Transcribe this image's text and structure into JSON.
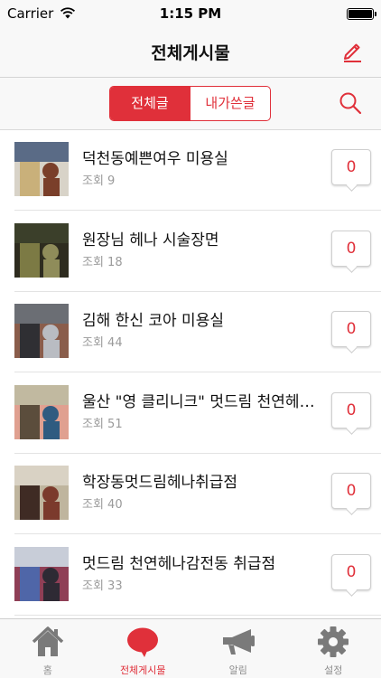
{
  "status_bar": {
    "carrier": "Carrier",
    "time": "1:15 PM"
  },
  "nav": {
    "title": "전체게시물"
  },
  "segment": {
    "all_label": "전체글",
    "mine_label": "내가쓴글"
  },
  "posts": [
    {
      "title": "덕천동예쁜여우 미용실",
      "views": "조회 9",
      "count": "0",
      "thumb_colors": [
        "#5a6b86",
        "#c9b07a",
        "#7a3f2a",
        "#d8d3c8"
      ]
    },
    {
      "title": "원장님  헤나 시술장면",
      "views": "조회 18",
      "count": "0",
      "thumb_colors": [
        "#3b3f2a",
        "#7c7a44",
        "#8f8c5a",
        "#2e2c1f"
      ]
    },
    {
      "title": "김해 한신 코아 미용실",
      "views": "조회 44",
      "count": "0",
      "thumb_colors": [
        "#6b6e74",
        "#2f2f33",
        "#b9bcc2",
        "#8a5d4b"
      ]
    },
    {
      "title": "울산 \"영 클리니크\" 멋드림 천연헤나 취급점",
      "views": "조회 51",
      "count": "0",
      "thumb_colors": [
        "#c1b9a0",
        "#5b4d3c",
        "#2f5b80",
        "#e0a090"
      ]
    },
    {
      "title": "학장동멋드림헤나취급점",
      "views": "조회 40",
      "count": "0",
      "thumb_colors": [
        "#d9d2c4",
        "#3f2b24",
        "#7b3a2c",
        "#bfb59e"
      ]
    },
    {
      "title": "멋드림 천연헤나감전동 취급점",
      "views": "조회 33",
      "count": "0",
      "thumb_colors": [
        "#c8cdd8",
        "#4f66a8",
        "#2e2a34",
        "#8f3f56"
      ]
    }
  ],
  "tabs": [
    {
      "label": "홈",
      "icon": "home-icon"
    },
    {
      "label": "전체게시물",
      "icon": "speech-bubble-icon"
    },
    {
      "label": "알림",
      "icon": "megaphone-icon"
    },
    {
      "label": "설정",
      "icon": "gear-icon"
    }
  ],
  "colors": {
    "accent": "#e0303a",
    "tab_inactive": "#8e8e8e",
    "icon_inactive": "#7a7a7a"
  }
}
